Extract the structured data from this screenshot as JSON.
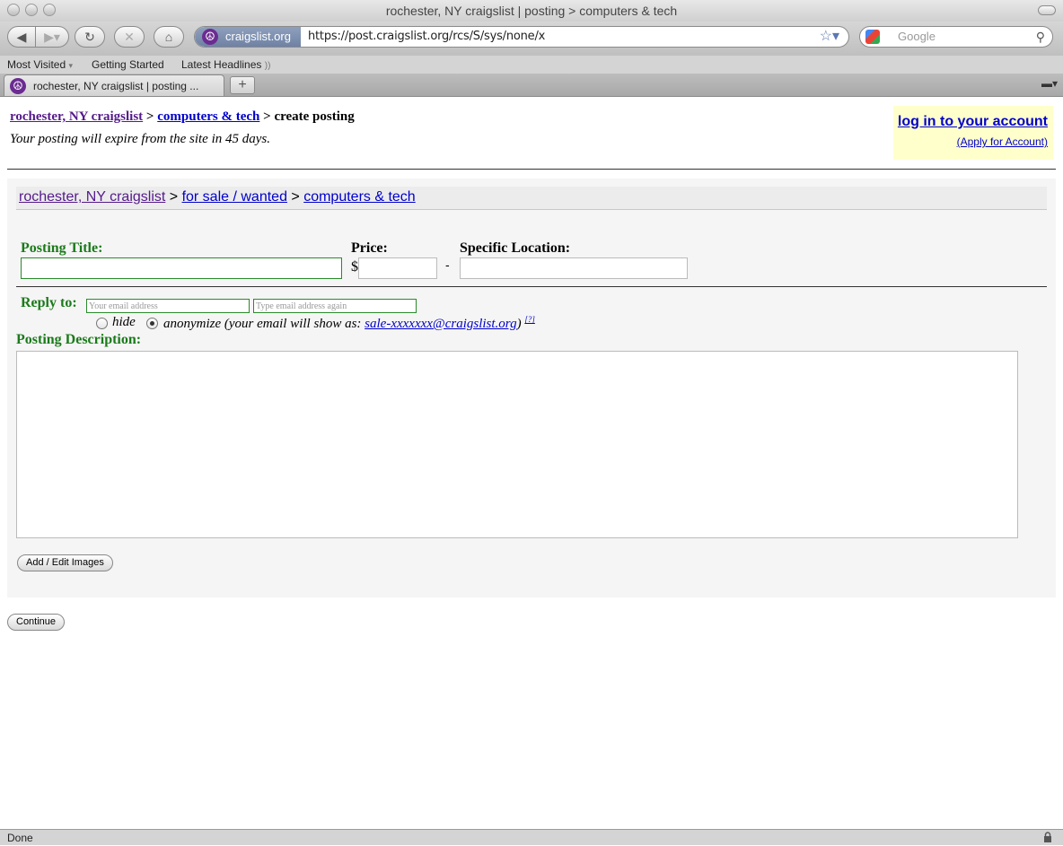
{
  "window": {
    "title": "rochester, NY craigslist | posting > computers & tech"
  },
  "navbar": {
    "site_badge": "craigslist.org",
    "url": "https://post.craigslist.org/rcs/S/sys/none/x",
    "search_placeholder": "Google"
  },
  "bookmarks": [
    "Most Visited",
    "Getting Started",
    "Latest Headlines"
  ],
  "tab": {
    "label": "rochester, NY craigslist | posting ...",
    "new_tab": "+"
  },
  "header": {
    "crumb_site": "rochester, NY craigslist",
    "sep1": " > ",
    "crumb_category": "computers & tech",
    "sep2": " > ",
    "crumb_current": "create posting",
    "expire_note": "Your posting will expire from the site in 45 days."
  },
  "account": {
    "login_label": "log in to your account",
    "apply_label": "(Apply for Account)"
  },
  "subcrumb": {
    "site": "rochester, NY craigslist",
    "sep1": " > ",
    "section": "for sale / wanted",
    "sep2": " > ",
    "category": "computers & tech"
  },
  "form": {
    "posting_title_label": "Posting Title:",
    "price_label": "Price:",
    "currency": "$",
    "dash": "-",
    "location_label": "Specific Location:",
    "reply_label": "Reply to:",
    "email_placeholder": "Your email address",
    "email_again_placeholder": "Type email address again",
    "hide_label": "hide",
    "anonymize_prefix": "anonymize (your email will show as: ",
    "anon_email": "sale-xxxxxxx@craigslist.org",
    "anonymize_suffix": ")",
    "help_link": "[?]",
    "description_label": "Posting Description:",
    "selected_reply_option": "anonymize"
  },
  "buttons": {
    "images": "Add / Edit Images",
    "continue": "Continue"
  },
  "status": {
    "text": "Done"
  }
}
